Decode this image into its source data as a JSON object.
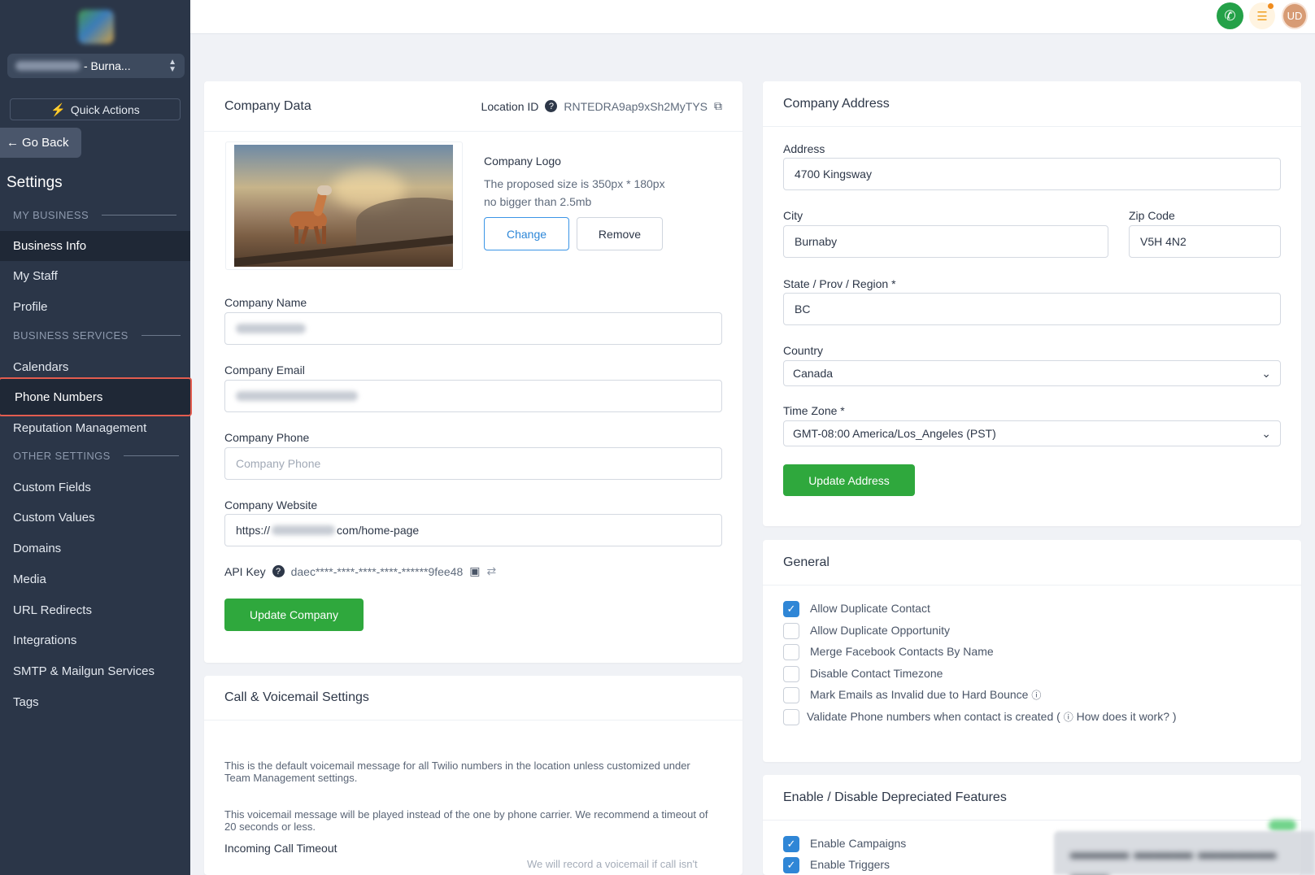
{
  "sidebar": {
    "location_suffix": "- Burna...",
    "quick_actions": "Quick Actions",
    "go_back": "Go Back",
    "settings_title": "Settings",
    "sections": {
      "my_business": "MY BUSINESS",
      "business_services": "BUSINESS SERVICES",
      "other_settings": "OTHER SETTINGS"
    },
    "items": {
      "business_info": "Business Info",
      "my_staff": "My Staff",
      "profile": "Profile",
      "calendars": "Calendars",
      "phone_numbers": "Phone Numbers",
      "reputation": "Reputation Management",
      "custom_fields": "Custom Fields",
      "custom_values": "Custom Values",
      "domains": "Domains",
      "media": "Media",
      "url_redirects": "URL Redirects",
      "integrations": "Integrations",
      "smtp": "SMTP & Mailgun Services",
      "tags": "Tags"
    },
    "active_item": "Business Info",
    "highlighted_item": "Phone Numbers"
  },
  "topbar": {
    "avatar_initials": "UD"
  },
  "company_data": {
    "title": "Company Data",
    "location_id_label": "Location ID",
    "location_id_value": "RNTEDRA9ap9xSh2MyTYS",
    "logo_label": "Company Logo",
    "logo_hint_1": "The proposed size is 350px * 180px",
    "logo_hint_2": "no bigger than 2.5mb",
    "change_btn": "Change",
    "remove_btn": "Remove",
    "name_label": "Company Name",
    "email_label": "Company Email",
    "phone_label": "Company Phone",
    "phone_placeholder": "Company Phone",
    "website_label": "Company Website",
    "website_prefix": "https://",
    "website_suffix": "com/home-page",
    "api_key_label": "API Key",
    "api_key_value": "daec****-****-****-****-******9fee48",
    "update_btn": "Update Company"
  },
  "call_voicemail": {
    "title": "Call & Voicemail Settings",
    "desc_1": "This is the default voicemail message for all Twilio numbers in the location unless customized under Team Management settings.",
    "desc_2": "This voicemail message will be played instead of the one by phone carrier. We recommend a timeout of 20 seconds or less.",
    "timeout_label": "Incoming Call Timeout",
    "timeout_hint": "We will record a voicemail if call isn't"
  },
  "company_address": {
    "title": "Company Address",
    "address_label": "Address",
    "address_value": "4700 Kingsway",
    "city_label": "City",
    "city_value": "Burnaby",
    "zip_label": "Zip Code",
    "zip_value": "V5H 4N2",
    "state_label": "State / Prov / Region *",
    "state_value": "BC",
    "country_label": "Country",
    "country_value": "Canada",
    "timezone_label": "Time Zone *",
    "timezone_value": "GMT-08:00 America/Los_Angeles (PST)",
    "update_btn": "Update Address"
  },
  "general": {
    "title": "General",
    "options": [
      {
        "label": "Allow Duplicate Contact",
        "checked": true
      },
      {
        "label": "Allow Duplicate Opportunity",
        "checked": false
      },
      {
        "label": "Merge Facebook Contacts By Name",
        "checked": false
      },
      {
        "label": "Disable Contact Timezone",
        "checked": false
      },
      {
        "label": "Mark Emails as Invalid due to Hard Bounce",
        "checked": false
      },
      {
        "label": "Validate Phone numbers when contact is created (",
        "checked": false
      }
    ],
    "how_link": "How does it work? )"
  },
  "deprecated": {
    "title": "Enable / Disable Depreciated Features",
    "options": [
      {
        "label": "Enable Campaigns",
        "checked": true
      },
      {
        "label": "Enable Triggers",
        "checked": true
      }
    ]
  },
  "colors": {
    "sidebar_bg": "#2b3648",
    "primary_green": "#2fa83d",
    "accent_blue": "#2f86d6",
    "highlight_red": "#e35c4f"
  }
}
